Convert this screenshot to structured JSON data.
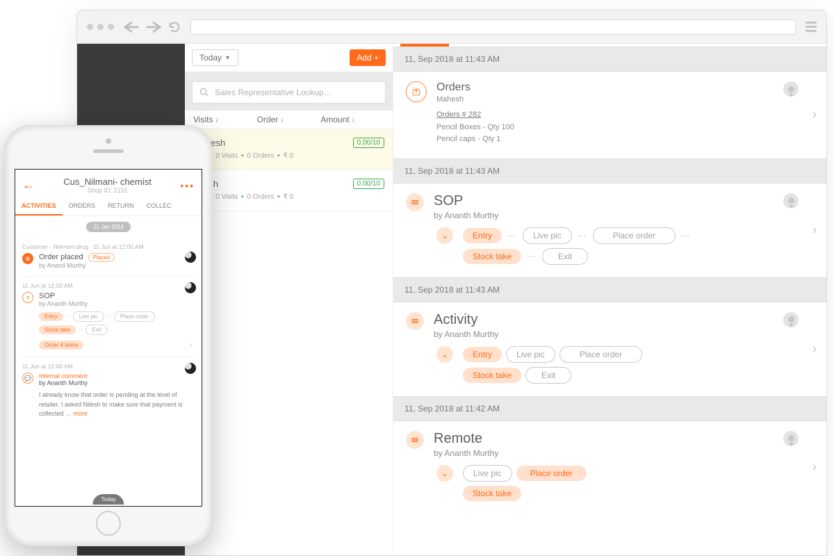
{
  "browser_nav": {
    "url": ""
  },
  "mid": {
    "today": "Today",
    "add": "Add +",
    "search_placeholder": "Sales Representative Lookup…",
    "heads": {
      "h1": "Visits",
      "h2": "Order",
      "h3": "Amount"
    },
    "rep1": {
      "name": "Mahesh",
      "sub": "Today: 0 Visits",
      "sub2": "0 Orders",
      "sub3": "₹ 0",
      "badge": "0.00/10"
    },
    "rep2": {
      "name": "Satish",
      "sub": "Today: 0 Visits",
      "sub2": "0 Orders",
      "sub3": "₹ 0",
      "badge": "0.00/10"
    }
  },
  "acts": {
    "ts1": "11, Sep 2018 at 11:43 AM",
    "orders": {
      "title": "Orders",
      "by": "Mahesh",
      "link": "Orders # 282",
      "l1": "Pencil Boxes - Qty 100",
      "l2": "Pencil caps - Qty 1"
    },
    "ts2": "11, Sep 2018 at 11:43 AM",
    "sop": {
      "title": "SOP",
      "by": "by Ananth Murthy",
      "p1": "Entry",
      "p2": "Live pic",
      "p3": "Place order",
      "p4": "Stock take",
      "p5": "Exit"
    },
    "ts3": "11, Sep 2018 at 11:43 AM",
    "activity": {
      "title": "Activity",
      "by": "by Ananth Murthy",
      "p1": "Entry",
      "p2": "Live pic",
      "p3": "Place order",
      "p4": "Stock take",
      "p5": "Exit"
    },
    "ts4": "11, Sep 2018 at 11:42 AM",
    "remote": {
      "title": "Remote",
      "by": "by Ananth Murthy",
      "p1": "Live pic",
      "p2": "Place order",
      "p3": "Stock take"
    }
  },
  "phone": {
    "title": "Cus_Nilmani- chemist",
    "subtitle": "Shop ID: 2131",
    "tabs": {
      "t1": "ACTIVITIES",
      "t2": "ORDERS",
      "t3": "RETURN",
      "t4": "COLLEC"
    },
    "date_chip": "21 Jan 2016",
    "c1": {
      "meta": "Customer - Nelmani drug",
      "ts": "11 Jun at 12:00 AM",
      "title": "Order placed",
      "badge": "Placed",
      "by": "by Anand Murthy"
    },
    "c2": {
      "ts": "11 Jun at 12:00 AM",
      "title": "SOP",
      "by": "by Ananth Murthy",
      "p1": "Entry",
      "p2": "Live pic",
      "p3": "Place order",
      "p4": "Stock take",
      "p5": "Exit",
      "p6": "Order 4 items"
    },
    "c3": {
      "ts": "11 Jun at 12:00 AM",
      "label": "Internal comment",
      "by": "by Ananth Murthy",
      "text": "I already know that order is pending at the level of retailer. I asked Nilesh to make sure that payment is collected … ",
      "more": "more"
    },
    "foot": "Today"
  }
}
